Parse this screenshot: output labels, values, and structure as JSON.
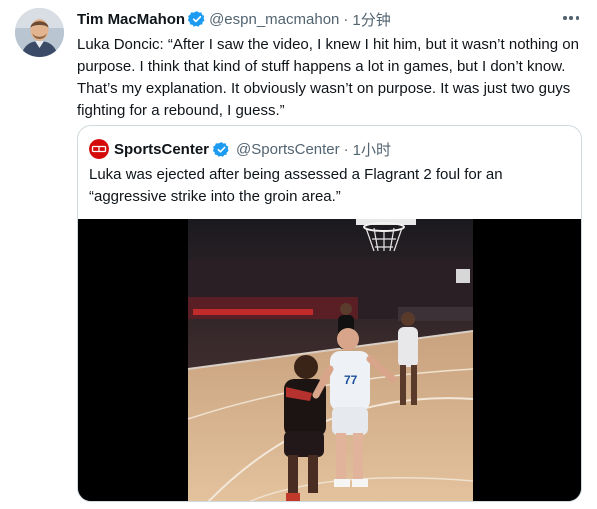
{
  "tweet": {
    "author_name": "Tim MacMahon",
    "handle": "@espn_macmahon",
    "separator": "·",
    "time": "1分钟",
    "text": "Luka Doncic: “After I saw the video, I knew I hit him, but it wasn’t nothing on purpose. I think that kind of stuff happens a lot in games, but I don’t know. That’s my explanation. It obviously wasn’t on purpose. It was just two guys fighting for a rebound, I guess.”"
  },
  "quoted_tweet": {
    "author_name": "SportsCenter",
    "handle": "@SportsCenter",
    "separator": "·",
    "time": "1小时",
    "text": "Luka was ejected after being assessed a Flagrant 2 foul for an “aggressive strike into the groin area.”",
    "player_jersey_number": "77"
  },
  "colors": {
    "verified_badge": "#1d9bf0",
    "sportscenter_logo": "#d50a0a",
    "secondary_text": "#536471",
    "border": "#cfd9de"
  },
  "icons": {
    "more": "more-icon",
    "verified": "verified-badge-icon"
  }
}
